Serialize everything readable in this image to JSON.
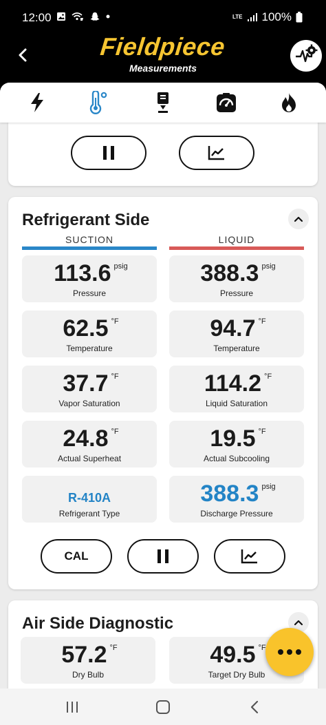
{
  "status_bar": {
    "time": "12:00",
    "network": "LTE",
    "battery": "100%"
  },
  "header": {
    "logo": "Fieldpiece",
    "subtitle": "Measurements"
  },
  "tabs": [
    {
      "icon": "lightning-icon",
      "active": false
    },
    {
      "icon": "thermometer-icon",
      "active": true
    },
    {
      "icon": "probe-icon",
      "active": false
    },
    {
      "icon": "gauge-icon",
      "active": false
    },
    {
      "icon": "flame-icon",
      "active": false
    }
  ],
  "refrigerant": {
    "title": "Refrigerant Side",
    "suction_label": "SUCTION",
    "liquid_label": "LIQUID",
    "suction_color": "#2a87c8",
    "liquid_color": "#d85a58",
    "tiles": [
      {
        "value": "113.6",
        "unit": "psig",
        "label": "Pressure"
      },
      {
        "value": "388.3",
        "unit": "psig",
        "label": "Pressure"
      },
      {
        "value": "62.5",
        "unit": "°F",
        "label": "Temperature"
      },
      {
        "value": "94.7",
        "unit": "°F",
        "label": "Temperature"
      },
      {
        "value": "37.7",
        "unit": "°F",
        "label": "Vapor Saturation"
      },
      {
        "value": "114.2",
        "unit": "°F",
        "label": "Liquid Saturation"
      },
      {
        "value": "24.8",
        "unit": "°F",
        "label": "Actual Superheat"
      },
      {
        "value": "19.5",
        "unit": "°F",
        "label": "Actual Subcooling"
      },
      {
        "value": "R-410A",
        "label": "Refrigerant Type"
      },
      {
        "value": "388.3",
        "unit": "psig",
        "label": "Discharge Pressure"
      }
    ],
    "cal_label": "CAL"
  },
  "air_side": {
    "title": "Air Side Diagnostic",
    "tiles": [
      {
        "value": "57.2",
        "unit": "°F",
        "label": "Dry Bulb"
      },
      {
        "value": "49.5",
        "unit": "°F",
        "label": "Target Dry Bulb"
      }
    ]
  },
  "colors": {
    "brand_yellow": "#f6c531",
    "value_blue": "#2384c6",
    "fab_yellow": "#f9c32b"
  }
}
